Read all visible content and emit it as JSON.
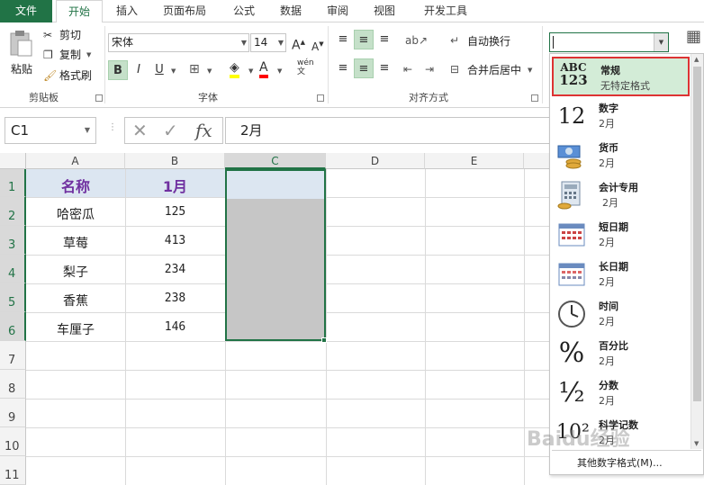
{
  "ribbon_tabs": [
    "文件",
    "开始",
    "插入",
    "页面布局",
    "公式",
    "数据",
    "审阅",
    "视图",
    "开发工具"
  ],
  "clipboard": {
    "paste": "粘贴",
    "cut": "剪切",
    "copy": "复制",
    "format_painter": "格式刷",
    "group": "剪贴板"
  },
  "font": {
    "name": "宋体",
    "size": "14",
    "bold": "B",
    "italic": "I",
    "underline": "U",
    "grow": "A",
    "shrink": "A",
    "font_color": "A",
    "phonetic": "wén",
    "group": "字体"
  },
  "alignment": {
    "wrap": "自动换行",
    "merge": "合并后居中",
    "group": "对齐方式"
  },
  "number": {
    "format_box_value": ""
  },
  "formula_bar": {
    "name_box": "C1",
    "cancel": "✕",
    "enter": "✓",
    "fx": "fx",
    "content": "2月"
  },
  "sheet": {
    "columns": [
      "A",
      "B",
      "C",
      "D",
      "E"
    ],
    "rows": [
      "1",
      "2",
      "3",
      "4",
      "5",
      "6",
      "7",
      "8",
      "9",
      "10",
      "11"
    ],
    "data": [
      [
        "名称",
        "1月"
      ],
      [
        "哈密瓜",
        "125"
      ],
      [
        "草莓",
        "413"
      ],
      [
        "梨子",
        "234"
      ],
      [
        "香蕉",
        "238"
      ],
      [
        "车厘子",
        "146"
      ]
    ]
  },
  "number_formats": [
    {
      "name": "常规",
      "sample": "无特定格式",
      "icon": "general-icon",
      "icon_text": "ABC\n123"
    },
    {
      "name": "数字",
      "sample": "2月",
      "icon": "number-icon",
      "icon_text": "12"
    },
    {
      "name": "货币",
      "sample": "2月",
      "icon": "currency-icon",
      "icon_text": ""
    },
    {
      "name": "会计专用",
      "sample": "2月",
      "icon": "accounting-icon",
      "icon_text": ""
    },
    {
      "name": "短日期",
      "sample": "2月",
      "icon": "short-date-icon",
      "icon_text": ""
    },
    {
      "name": "长日期",
      "sample": "2月",
      "icon": "long-date-icon",
      "icon_text": ""
    },
    {
      "name": "时间",
      "sample": "2月",
      "icon": "clock-icon",
      "icon_text": ""
    },
    {
      "name": "百分比",
      "sample": "2月",
      "icon": "percent-icon",
      "icon_text": "%"
    },
    {
      "name": "分数",
      "sample": "2月",
      "icon": "fraction-icon",
      "icon_text": "½"
    },
    {
      "name": "科学记数",
      "sample": "2月",
      "icon": "scientific-icon",
      "icon_text": "10²"
    }
  ],
  "more_formats": "其他数字格式(M)...",
  "watermark": "Baidu经验",
  "colors": {
    "accent": "#217346",
    "header_text": "#7030a0",
    "row1_fill": "#dce6f1",
    "selection_fill": "#c6c6c6",
    "highlight_border": "#dd3333"
  }
}
